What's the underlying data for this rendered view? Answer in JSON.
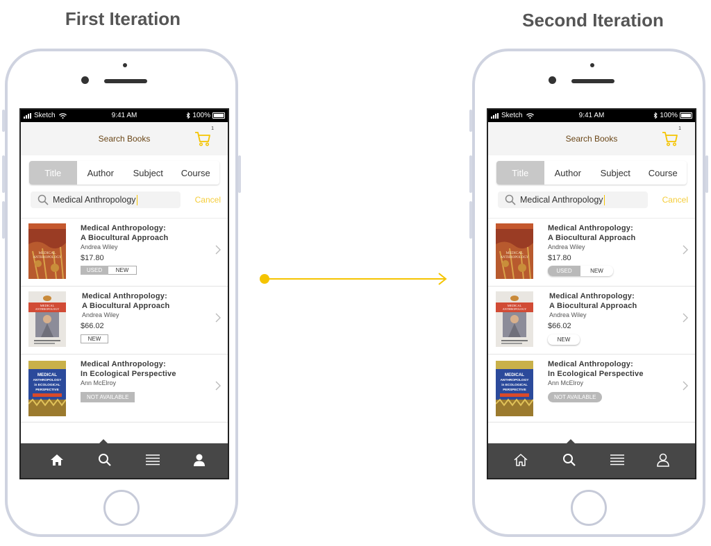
{
  "left_heading": "First Iteration",
  "right_heading": "Second Iteration",
  "status_bar": {
    "carrier": "Sketch",
    "time": "9:41 AM",
    "battery": "100%"
  },
  "header": {
    "title": "Search Books",
    "cart_count": "1"
  },
  "tabs": [
    "Title",
    "Author",
    "Subject",
    "Course"
  ],
  "search": {
    "query": "Medical Anthropology",
    "cancel_label": "Cancel"
  },
  "books": [
    {
      "title_line1": "Medical Anthropology:",
      "title_line2": "A Biocultural Approach",
      "author": "Andrea Wiley",
      "price": "$17.80",
      "options": [
        "USED",
        "NEW"
      ]
    },
    {
      "title_line1": "Medical Anthropology:",
      "title_line2": "A Biocultural Approach",
      "author": "Andrea Wiley",
      "price": "$66.02",
      "options": [
        "NEW"
      ]
    },
    {
      "title_line1": "Medical Anthropology:",
      "title_line2": "In Ecological Perspective",
      "author": "Ann McElroy",
      "status": "NOT AVAILABLE"
    }
  ],
  "covers": {
    "cover1": {
      "line1": "MEDICAL",
      "line2": "ANTHROPOLOGY"
    },
    "cover2": {
      "line1": "MEDICAL",
      "line2": "ANTHROPOLOGY"
    },
    "cover3": {
      "line1": "MEDICAL",
      "line2": "ANTHROPOLOGY",
      "line3": "in ECOLOGICAL",
      "line4": "PERSPECTIVE"
    }
  },
  "tab_bar_icons": [
    "home-icon",
    "search-icon",
    "list-icon",
    "profile-icon"
  ],
  "colors": {
    "accent": "#f5c400",
    "header_title": "#6a4617",
    "tab_bar": "#474747",
    "active_tab": "#c8c8c8"
  }
}
